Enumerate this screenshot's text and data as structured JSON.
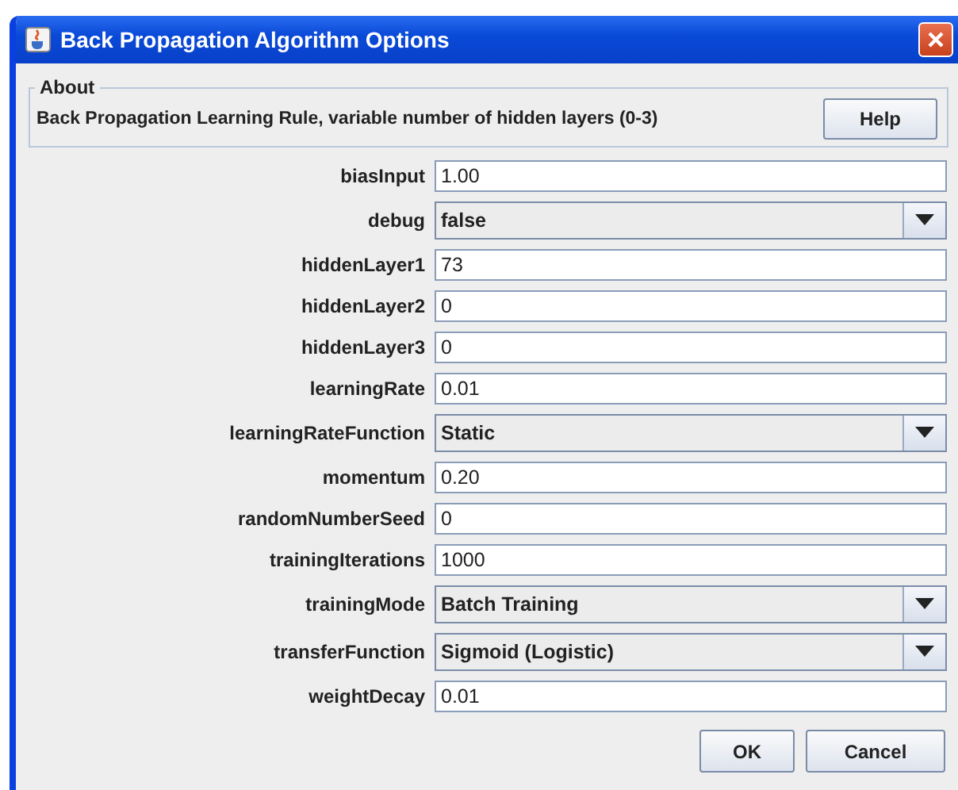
{
  "window": {
    "title": "Back Propagation Algorithm Options"
  },
  "about": {
    "legend": "About",
    "text": "Back Propagation Learning Rule, variable number of hidden layers (0-3)",
    "help_button": "Help"
  },
  "fields": [
    {
      "label": "biasInput",
      "kind": "text",
      "value": "1.00"
    },
    {
      "label": "debug",
      "kind": "combo",
      "value": "false"
    },
    {
      "label": "hiddenLayer1",
      "kind": "text",
      "value": "73"
    },
    {
      "label": "hiddenLayer2",
      "kind": "text",
      "value": "0"
    },
    {
      "label": "hiddenLayer3",
      "kind": "text",
      "value": "0"
    },
    {
      "label": "learningRate",
      "kind": "text",
      "value": "0.01"
    },
    {
      "label": "learningRateFunction",
      "kind": "combo",
      "value": "Static"
    },
    {
      "label": "momentum",
      "kind": "text",
      "value": "0.20"
    },
    {
      "label": "randomNumberSeed",
      "kind": "text",
      "value": "0"
    },
    {
      "label": "trainingIterations",
      "kind": "text",
      "value": "1000"
    },
    {
      "label": "trainingMode",
      "kind": "combo",
      "value": "Batch Training"
    },
    {
      "label": "transferFunction",
      "kind": "combo",
      "value": "Sigmoid (Logistic)"
    },
    {
      "label": "weightDecay",
      "kind": "text",
      "value": "0.01"
    }
  ],
  "buttons": [
    "OK",
    "Cancel"
  ]
}
